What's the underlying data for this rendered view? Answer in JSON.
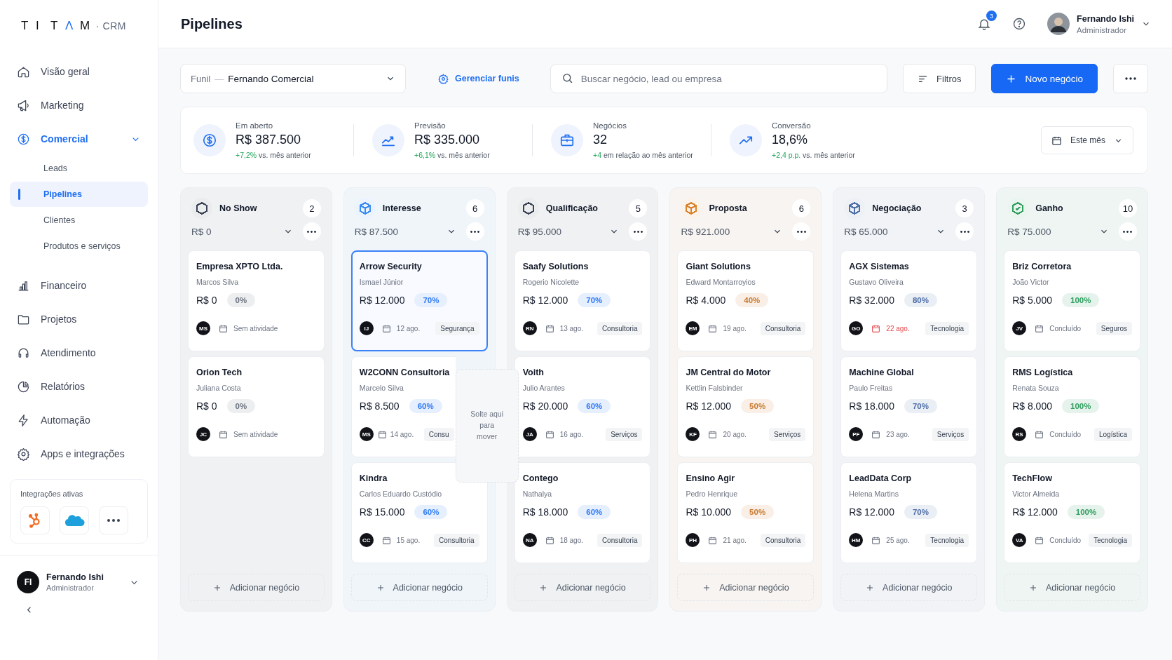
{
  "brand": {
    "letters": [
      {
        "text": "T",
        "accent": false
      },
      {
        "text": "I",
        "accent": false
      },
      {
        "text": "T",
        "accent": false
      },
      {
        "text": "Λ",
        "accent": true
      },
      {
        "text": "M",
        "accent": false
      }
    ],
    "suffix": "· CRM"
  },
  "sidebar": {
    "items": [
      {
        "label": "Visão geral",
        "selected": false
      },
      {
        "label": "Marketing",
        "selected": false
      },
      {
        "label": "Comercial",
        "selected": true,
        "expanded": true,
        "children": [
          {
            "label": "Leads",
            "selected": false
          },
          {
            "label": "Pipelines",
            "selected": true
          },
          {
            "label": "Clientes",
            "selected": false
          },
          {
            "label": "Produtos e serviços",
            "selected": false
          }
        ]
      },
      {
        "label": "Financeiro",
        "selected": false
      },
      {
        "label": "Projetos",
        "selected": false
      },
      {
        "label": "Atendimento",
        "selected": false
      },
      {
        "label": "Relatórios",
        "selected": false
      },
      {
        "label": "Automação",
        "selected": false
      },
      {
        "label": "Apps e integrações",
        "selected": false
      }
    ],
    "integrations": {
      "title": "Integrações ativas"
    },
    "user": {
      "initials": "FI",
      "name": "Fernando Ishi",
      "role": "Administrador"
    }
  },
  "header": {
    "title": "Pipelines",
    "notifications": "3",
    "user": {
      "name": "Fernando Ishi",
      "role": "Administrador"
    }
  },
  "toolbar": {
    "funnel": {
      "label": "Funil",
      "separator": "—",
      "value": "Fernando Comercial"
    },
    "manage": "Gerenciar funis",
    "search": {
      "placeholder": "Buscar negócio, lead ou empresa"
    },
    "filters": "Filtros",
    "new_deal": "Novo negócio"
  },
  "stats": {
    "items": [
      {
        "label": "Em aberto",
        "value": "R$ 387.500",
        "delta": "+7,2%",
        "note": "vs. mês anterior"
      },
      {
        "label": "Previsão",
        "value": "R$ 335.000",
        "delta": "+6,1%",
        "note": "vs. mês anterior"
      },
      {
        "label": "Negócios",
        "value": "32",
        "delta": "+4",
        "note": "em relação ao mês anterior"
      },
      {
        "label": "Conversão",
        "value": "18,6%",
        "delta": "+2,4 p.p.",
        "note": "vs. mês anterior"
      }
    ],
    "period": "Este mês"
  },
  "columns": [
    {
      "name": "No Show",
      "count": "2",
      "total": "R$ 0",
      "color": "#374151",
      "add_label": "Adicionar negócio",
      "cards": [
        {
          "company": "Empresa XPTO Ltda.",
          "contact": "Marcos Silva",
          "value": "R$ 0",
          "probability": "0%",
          "color": "#6b7280",
          "initials": "MS",
          "date": "Sem atividade",
          "overdue": false,
          "selected": false
        },
        {
          "company": "Orion Tech",
          "contact": "Juliana Costa",
          "value": "R$ 0",
          "probability": "0%",
          "color": "#6b7280",
          "initials": "JC",
          "date": "Sem atividade",
          "overdue": false,
          "selected": false
        }
      ]
    },
    {
      "name": "Interesse",
      "count": "6",
      "total": "R$ 87.500",
      "color": "#3b8cf0",
      "add_label": "Adicionar negócio",
      "cards": [
        {
          "company": "Arrow Security",
          "contact": "Ismael Júnior",
          "value": "R$ 12.000",
          "probability": "70%",
          "color": "#2f7bf5",
          "initials": "IJ",
          "date": "12 ago.",
          "overdue": false,
          "tag": "Segurança",
          "selected": true
        },
        {
          "company": "W2CONN Consultoria",
          "contact": "Marcelo Silva",
          "value": "R$ 8.500",
          "probability": "60%",
          "color": "#2f7bf5",
          "initials": "MS",
          "date": "14 ago.",
          "overdue": false,
          "tag": "Consu",
          "selected": false,
          "drop_zone": "Solte aqui para mover"
        },
        {
          "company": "Kindra",
          "contact": "Carlos Eduardo Custódio",
          "value": "R$ 15.000",
          "probability": "60%",
          "color": "#2f7bf5",
          "initials": "CC",
          "date": "15 ago.",
          "overdue": false,
          "tag": "Consultoria",
          "selected": false
        }
      ]
    },
    {
      "name": "Qualificação",
      "count": "5",
      "total": "R$ 95.000",
      "color": "#374151",
      "add_label": "Adicionar negócio",
      "cards": [
        {
          "company": "Saafy Solutions",
          "contact": "Rogerio Nicolette",
          "value": "R$ 12.000",
          "probability": "70%",
          "color": "#2f7bf5",
          "initials": "RN",
          "date": "13 ago.",
          "overdue": false,
          "tag": "Consultoria",
          "selected": false
        },
        {
          "company": "Voith",
          "contact": "Julio Arantes",
          "value": "R$ 20.000",
          "probability": "60%",
          "color": "#2f7bf5",
          "initials": "JA",
          "date": "16 ago.",
          "overdue": false,
          "tag": "Serviços",
          "selected": false
        },
        {
          "company": "Contego",
          "contact": "Nathalya",
          "value": "R$ 18.000",
          "probability": "60%",
          "color": "#2f7bf5",
          "initials": "NA",
          "date": "18 ago.",
          "overdue": false,
          "tag": "Consultoria",
          "selected": false
        }
      ]
    },
    {
      "name": "Proposta",
      "count": "6",
      "total": "R$ 921.000",
      "color": "#d9822b",
      "add_label": "Adicionar negócio",
      "cards": [
        {
          "company": "Giant Solutions",
          "contact": "Edward Montarroyios",
          "value": "R$ 4.000",
          "probability": "40%",
          "color": "#c97a2e",
          "initials": "EM",
          "date": "19 ago.",
          "overdue": false,
          "tag": "Consultoria",
          "selected": false
        },
        {
          "company": "JM Central do Motor",
          "contact": "Kettlin Falsbinder",
          "value": "R$ 12.000",
          "probability": "50%",
          "color": "#c97a2e",
          "initials": "KF",
          "date": "20 ago.",
          "overdue": false,
          "tag": "Serviços",
          "selected": false
        },
        {
          "company": "Ensino Agir",
          "contact": "Pedro Henrique",
          "value": "R$ 10.000",
          "probability": "50%",
          "color": "#c97a2e",
          "initials": "PH",
          "date": "21 ago.",
          "overdue": false,
          "tag": "Consultoria",
          "selected": false
        }
      ]
    },
    {
      "name": "Negociação",
      "count": "3",
      "total": "R$ 65.000",
      "color": "#4f6fa8",
      "add_label": "Adicionar negócio",
      "cards": [
        {
          "company": "AGX Sistemas",
          "contact": "Gustavo Oliveira",
          "value": "R$ 32.000",
          "probability": "80%",
          "color": "#4f6fa8",
          "initials": "GO",
          "date": "22 ago.",
          "overdue": true,
          "tag": "Tecnologia",
          "selected": false
        },
        {
          "company": "Machine Global",
          "contact": "Paulo Freitas",
          "value": "R$ 18.000",
          "probability": "70%",
          "color": "#4f6fa8",
          "initials": "PF",
          "date": "23 ago.",
          "overdue": false,
          "tag": "Serviços",
          "selected": false
        },
        {
          "company": "LeadData Corp",
          "contact": "Helena Martins",
          "value": "R$ 12.000",
          "probability": "70%",
          "color": "#4f6fa8",
          "initials": "HM",
          "date": "25 ago.",
          "overdue": false,
          "tag": "Tecnologia",
          "selected": false
        }
      ]
    },
    {
      "name": "Ganho",
      "count": "10",
      "total": "R$ 75.000",
      "color": "#2f9e5f",
      "add_label": "Adicionar negócio",
      "cards": [
        {
          "company": "Briz Corretora",
          "contact": "João Victor",
          "value": "R$ 5.000",
          "probability": "100%",
          "color": "#2f9e5f",
          "initials": "JV",
          "date": "Concluído",
          "overdue": false,
          "tag": "Seguros",
          "selected": false
        },
        {
          "company": "RMS Logística",
          "contact": "Renata Souza",
          "value": "R$ 8.000",
          "probability": "100%",
          "color": "#2f9e5f",
          "initials": "RS",
          "date": "Concluído",
          "overdue": false,
          "tag": "Logística",
          "selected": false
        },
        {
          "company": "TechFlow",
          "contact": "Victor Almeida",
          "value": "R$ 12.000",
          "probability": "100%",
          "color": "#2f9e5f",
          "initials": "VA",
          "date": "Concluído",
          "overdue": false,
          "tag": "Tecnologia",
          "selected": false
        }
      ]
    }
  ]
}
